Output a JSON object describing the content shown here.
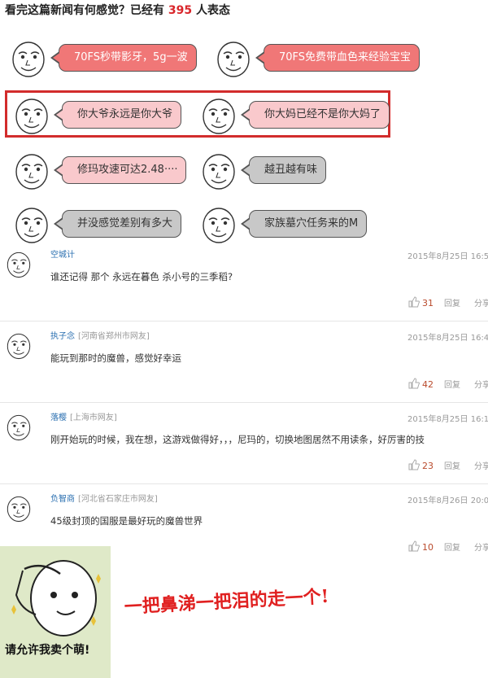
{
  "header": {
    "prefix": "看完这篇新闻有何感觉？已经有",
    "count": "395",
    "suffix": "人表态"
  },
  "reactions": [
    {
      "label": "70FS秒带影牙，5g一波"
    },
    {
      "label": "70FS免费带血色来经验宝宝"
    },
    {
      "label": "你大爷永远是你大爷"
    },
    {
      "label": "你大妈已经不是你大妈了"
    },
    {
      "label": "修玛攻速可达2.48····"
    },
    {
      "label": "越丑越有味"
    },
    {
      "label": "并没感觉差别有多大"
    },
    {
      "label": "家族墓穴任务来的M"
    }
  ],
  "comments": [
    {
      "user": "空城计",
      "location": "",
      "time": "2015年8月25日 16:5",
      "text": "谁还记得 那个 永远在暮色 杀小号的三季稻?",
      "likes": "31",
      "reply": "回复",
      "share": "分享"
    },
    {
      "user": "执子念",
      "location": "[河南省郑州市网友]",
      "time": "2015年8月25日 16:4",
      "text": "能玩到那时的魔兽，感觉好幸运",
      "likes": "42",
      "reply": "回复",
      "share": "分享"
    },
    {
      "user": "落樱",
      "location": "[上海市网友]",
      "time": "2015年8月25日 16:1",
      "text": "刚开始玩的时候，我在想，这游戏做得好，，，尼玛的，切换地图居然不用读条，好厉害的技",
      "likes": "23",
      "reply": "回复",
      "share": "分享"
    },
    {
      "user": "负智商",
      "location": "[河北省石家庄市网友]",
      "time": "2015年8月26日 20:0",
      "text": "45级封顶的国服是最好玩的魔兽世界",
      "likes": "10",
      "reply": "回复",
      "share": "分享"
    }
  ],
  "meme": {
    "caption": "请允许我卖个萌!",
    "slogan": "一把鼻涕一把泪的走一个!"
  },
  "colors": {
    "accent_red": "#d9262b",
    "bubble_red": "#f07777",
    "bubble_pink": "#f9c9cc",
    "bubble_gray": "#c8c8c8",
    "link_blue": "#2a6fb0"
  }
}
